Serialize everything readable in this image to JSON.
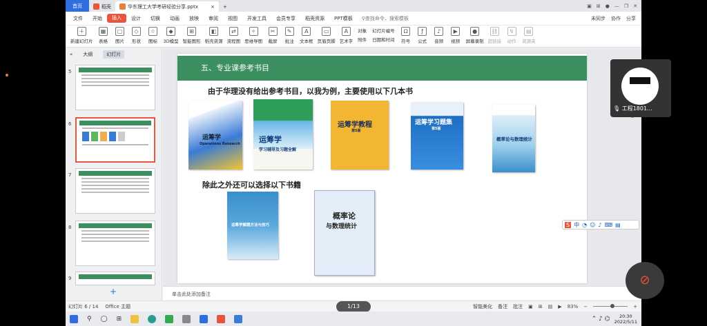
{
  "tabs": {
    "home": "首页",
    "wps": "稻壳",
    "file": "华东理工大学考研经验分享.pptx"
  },
  "menus": [
    "文件",
    "开始",
    "插入",
    "设计",
    "切换",
    "动画",
    "放映",
    "审阅",
    "视图",
    "开发工具",
    "会员专享",
    "稻壳资源",
    "PPT模板"
  ],
  "active_menu": "插入",
  "search_text": "查找命令、搜索模板",
  "menu_right": {
    "sync": "未同步",
    "collab": "协作",
    "share": "分享"
  },
  "ribbon_items": [
    "新建幻灯片",
    "表格",
    "图片",
    "形状",
    "图标",
    "3D模型",
    "智能图形",
    "稻壳资源",
    "流程图",
    "思维导图",
    "截屏",
    "批注",
    "文本框",
    "页眉页脚",
    "艺术字",
    "附件",
    "日期和时间",
    "符号",
    "公式",
    "音频",
    "视频",
    "屏幕录制",
    "超链接",
    "动作",
    "资源夹"
  ],
  "ribbon_small": {
    "obj": "对象",
    "slide_num": "幻灯片编号"
  },
  "panel_tabs": {
    "outline": "大纲",
    "slides": "幻灯片"
  },
  "thumb_numbers": [
    "5",
    "6",
    "7",
    "8",
    "9"
  ],
  "slide": {
    "header": "五、专业课参考书目",
    "line1": "由于华理没有给出参考书目，以我为例，主要使用以下几本书",
    "line2": "除此之外还可以选择以下书籍",
    "books": [
      {
        "title": "运筹学",
        "sub": "Operations Research"
      },
      {
        "title": "运筹学",
        "sub": "学习辅导及习题全解"
      },
      {
        "title": "运筹学教程",
        "sub": "第5版"
      },
      {
        "title": "运筹学习题集",
        "sub": "第5版"
      },
      {
        "title": "概率论与数理统计",
        "sub": ""
      },
      {
        "title": "运筹学解题方法与技巧",
        "sub": ""
      },
      {
        "title": "概率论",
        "sub": "与数理统计"
      }
    ]
  },
  "notes": "单击此处添加备注",
  "status": {
    "slide": "幻灯片 6 / 14",
    "theme": "Office 主题",
    "beauty": "智能美化",
    "notes": "备注",
    "comment": "批注",
    "zoom": "83%",
    "page": "1/13"
  },
  "clock": {
    "time": "20:30",
    "date": "2022/5/11"
  },
  "webcam": {
    "name": "工程1801..."
  }
}
